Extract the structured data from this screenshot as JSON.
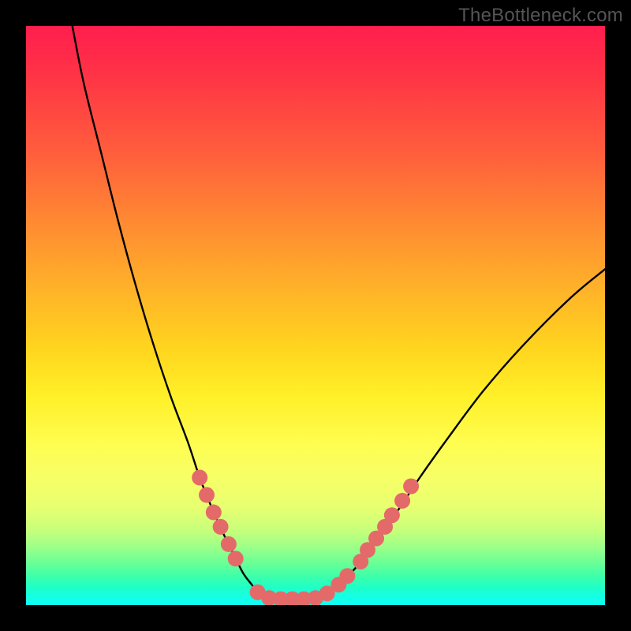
{
  "watermark": "TheBottleneck.com",
  "chart_data": {
    "type": "line",
    "title": "",
    "xlabel": "",
    "ylabel": "",
    "xlim": [
      0,
      100
    ],
    "ylim": [
      0,
      100
    ],
    "series": [
      {
        "name": "curve-left",
        "x": [
          8,
          10,
          13,
          16,
          19,
          22,
          25,
          28,
          30,
          32,
          34,
          36,
          37.5,
          39,
          40,
          41,
          42
        ],
        "y": [
          100,
          90,
          78,
          66,
          55,
          45,
          36,
          28,
          22,
          17,
          12.5,
          8.5,
          5.5,
          3.5,
          2.2,
          1.5,
          1.2
        ]
      },
      {
        "name": "curve-center",
        "x": [
          42,
          44,
          46,
          48,
          50
        ],
        "y": [
          1.2,
          1.0,
          1.0,
          1.0,
          1.2
        ]
      },
      {
        "name": "curve-right",
        "x": [
          50,
          52,
          54,
          57,
          60,
          64,
          68,
          73,
          79,
          86,
          94,
          100
        ],
        "y": [
          1.2,
          2.0,
          3.5,
          6.5,
          10.5,
          16,
          22,
          29,
          37,
          45,
          53,
          58
        ]
      }
    ],
    "markers": {
      "name": "dots",
      "color": "#e46a6a",
      "radius_px": 10,
      "points": [
        {
          "x": 30.0,
          "y": 22.0
        },
        {
          "x": 31.2,
          "y": 19.0
        },
        {
          "x": 32.4,
          "y": 16.0
        },
        {
          "x": 33.6,
          "y": 13.5
        },
        {
          "x": 35.0,
          "y": 10.5
        },
        {
          "x": 36.2,
          "y": 8.0
        },
        {
          "x": 40.0,
          "y": 2.2
        },
        {
          "x": 42.0,
          "y": 1.2
        },
        {
          "x": 44.0,
          "y": 1.0
        },
        {
          "x": 46.0,
          "y": 1.0
        },
        {
          "x": 48.0,
          "y": 1.0
        },
        {
          "x": 50.0,
          "y": 1.2
        },
        {
          "x": 52.0,
          "y": 2.0
        },
        {
          "x": 54.0,
          "y": 3.5
        },
        {
          "x": 55.5,
          "y": 5.0
        },
        {
          "x": 57.8,
          "y": 7.5
        },
        {
          "x": 59.0,
          "y": 9.5
        },
        {
          "x": 60.5,
          "y": 11.5
        },
        {
          "x": 62.0,
          "y": 13.5
        },
        {
          "x": 63.2,
          "y": 15.5
        },
        {
          "x": 65.0,
          "y": 18.0
        },
        {
          "x": 66.5,
          "y": 20.5
        }
      ]
    },
    "grid": false,
    "legend": false
  }
}
